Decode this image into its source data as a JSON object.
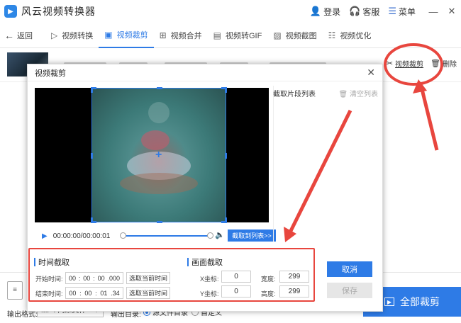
{
  "app": {
    "title": "风云视频转换器",
    "login": "登录",
    "service": "客服",
    "menu": "菜单"
  },
  "nav": {
    "back": "返回",
    "tabs": [
      {
        "label": "视频转换",
        "active": false
      },
      {
        "label": "视频裁剪",
        "active": true
      },
      {
        "label": "视频合并",
        "active": false
      },
      {
        "label": "视频转GIF",
        "active": false
      },
      {
        "label": "视频截图",
        "active": false
      },
      {
        "label": "视频优化",
        "active": false
      }
    ]
  },
  "file_row": {
    "crop_action": "视频裁剪",
    "delete_action": "删除"
  },
  "dialog": {
    "title": "视频裁剪",
    "time_display": "00:00:00/00:00:01",
    "to_list": "截取到列表>>",
    "clip_list_title": "截取片段列表",
    "clear_list": "清空列表",
    "time_section": {
      "title": "时间截取",
      "start_label": "开始时间:",
      "start": [
        "00",
        "00",
        "00",
        ".000"
      ],
      "end_label": "结束时间:",
      "end": [
        "00",
        "00",
        "01",
        ".34"
      ],
      "pick_current": "选取当前时间"
    },
    "frame_section": {
      "title": "画面截取",
      "x_label": "X坐标:",
      "x": "0",
      "y_label": "Y坐标:",
      "y": "0",
      "width_label": "宽度:",
      "width": "299",
      "height_label": "高度:",
      "height": "299"
    },
    "cancel": "取消",
    "save": "保存"
  },
  "bottom": {
    "format_label": "输出格式:",
    "format_value": "MP4 同原文件",
    "output_dir_label": "输出目录:",
    "radio_source": "源文件目录",
    "radio_custom": "自定义",
    "cut_all": "全部裁剪"
  },
  "colors": {
    "accent": "#2e7be6",
    "annotation": "#e8463e"
  }
}
